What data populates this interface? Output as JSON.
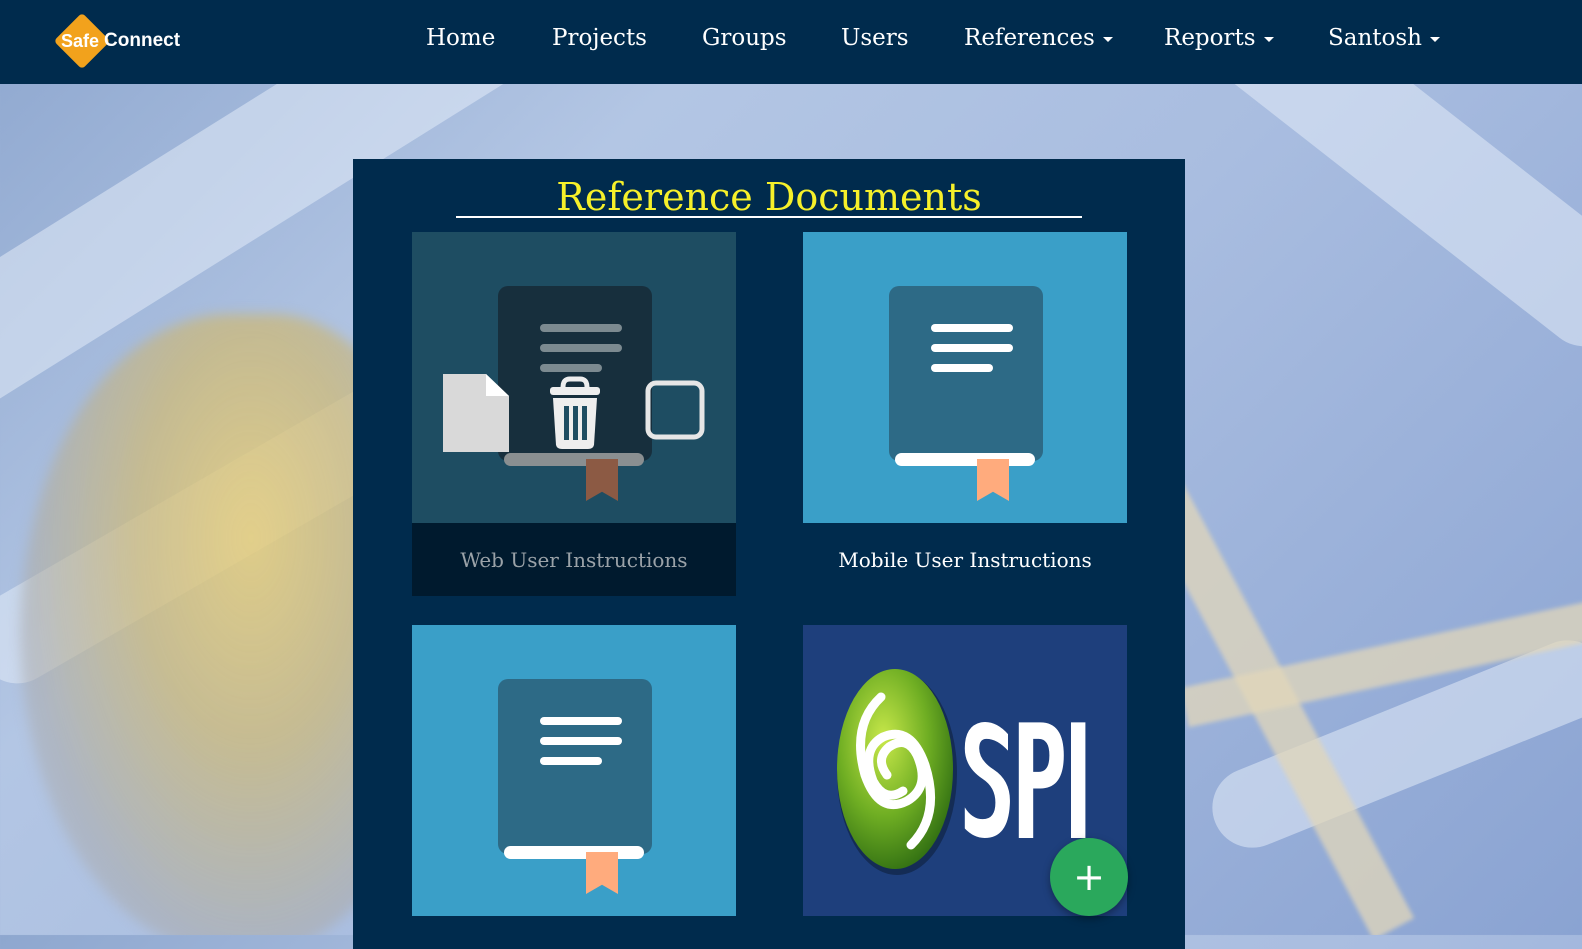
{
  "brand": {
    "name_part1": "Safe",
    "name_part2": "Connect",
    "accent_color": "#f2a21c"
  },
  "nav": {
    "items": [
      {
        "label": "Home",
        "dropdown": false
      },
      {
        "label": "Projects",
        "dropdown": false
      },
      {
        "label": "Groups",
        "dropdown": false
      },
      {
        "label": "Users",
        "dropdown": false
      },
      {
        "label": "References",
        "dropdown": true
      },
      {
        "label": "Reports",
        "dropdown": true
      },
      {
        "label": "Santosh",
        "dropdown": true
      }
    ]
  },
  "panel": {
    "title": "Reference Documents",
    "title_color": "#f6f02a",
    "cards": [
      {
        "label": "Web User Instructions",
        "icon": "book-icon",
        "state": "hovered",
        "hover_actions": [
          "file-icon",
          "trash-icon",
          "checkbox-icon"
        ]
      },
      {
        "label": "Mobile User Instructions",
        "icon": "book-icon"
      },
      {
        "label": "",
        "icon": "book-icon"
      },
      {
        "label": "",
        "icon": "spi-logo"
      }
    ]
  },
  "fab": {
    "label": "+",
    "icon": "add-icon",
    "color": "#2aa85c"
  }
}
